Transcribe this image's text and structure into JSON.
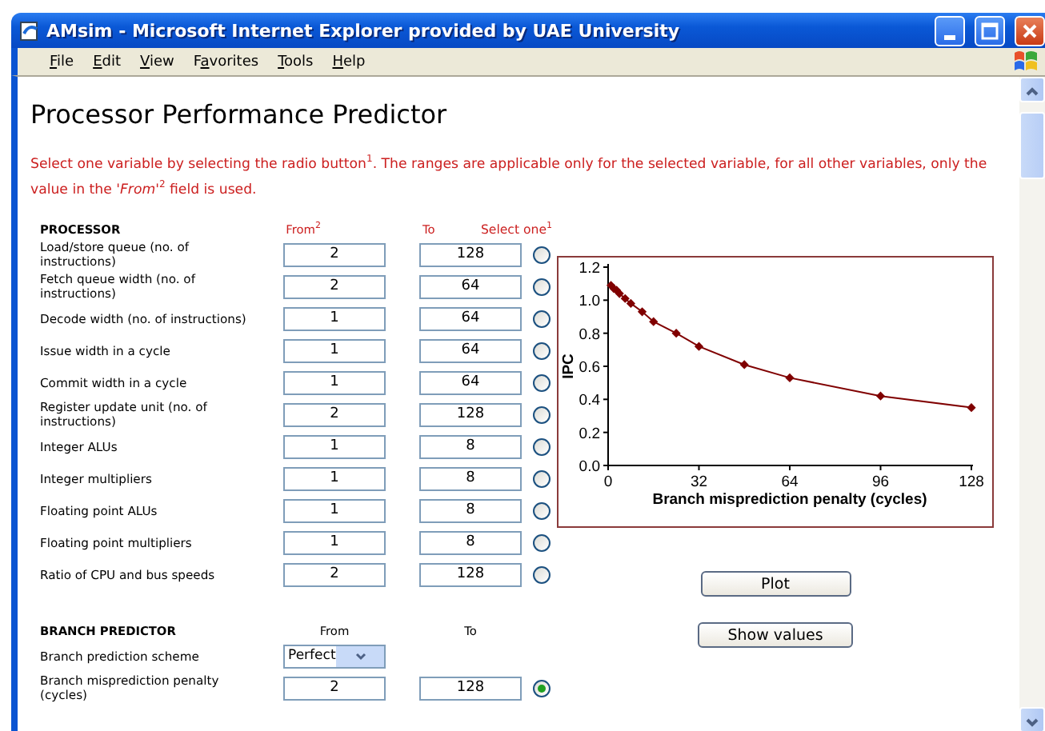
{
  "window": {
    "title": "AMsim - Microsoft Internet Explorer provided by UAE University"
  },
  "menu": [
    {
      "parts": [
        {
          "text": "F",
          "underlined": true
        },
        {
          "text": "ile",
          "underlined": false
        }
      ]
    },
    {
      "parts": [
        {
          "text": "E",
          "underlined": true
        },
        {
          "text": "dit",
          "underlined": false
        }
      ]
    },
    {
      "parts": [
        {
          "text": "V",
          "underlined": true
        },
        {
          "text": "iew",
          "underlined": false
        }
      ]
    },
    {
      "parts": [
        {
          "text": "F",
          "underlined": false
        },
        {
          "text": "a",
          "underlined": true
        },
        {
          "text": "vorites",
          "underlined": false
        }
      ]
    },
    {
      "parts": [
        {
          "text": "T",
          "underlined": true
        },
        {
          "text": "ools",
          "underlined": false
        }
      ]
    },
    {
      "parts": [
        {
          "text": "H",
          "underlined": true
        },
        {
          "text": "elp",
          "underlined": false
        }
      ]
    }
  ],
  "page": {
    "title": "Processor Performance Predictor",
    "intro": "Select one variable by selecting the radio button$^{1}$. The ranges are applicable only for the selected variable, for all other variables, only the value in the *'From'*$^{2}$ field is used."
  },
  "processor": {
    "heading": "PROCESSOR",
    "columns": {
      "from": "From$^{2}$",
      "to": "To",
      "select": "Select one$^{1}$"
    },
    "rows": [
      {
        "label": "Load/store queue (no. of instructions)",
        "from": "2",
        "to": "128",
        "selected": false
      },
      {
        "label": "Fetch queue width (no. of instructions)",
        "from": "2",
        "to": "64",
        "selected": false
      },
      {
        "label": "Decode width (no. of instructions)",
        "from": "1",
        "to": "64",
        "selected": false
      },
      {
        "label": "Issue width in a cycle",
        "from": "1",
        "to": "64",
        "selected": false
      },
      {
        "label": "Commit width in a cycle",
        "from": "1",
        "to": "64",
        "selected": false
      },
      {
        "label": "Register update unit (no. of instructions)",
        "from": "2",
        "to": "128",
        "selected": false
      },
      {
        "label": "Integer ALUs",
        "from": "1",
        "to": "8",
        "selected": false
      },
      {
        "label": "Integer multipliers",
        "from": "1",
        "to": "8",
        "selected": false
      },
      {
        "label": "Floating point ALUs",
        "from": "1",
        "to": "8",
        "selected": false
      },
      {
        "label": "Floating point multipliers",
        "from": "1",
        "to": "8",
        "selected": false
      },
      {
        "label": "Ratio of CPU and bus speeds",
        "from": "2",
        "to": "128",
        "selected": false
      }
    ]
  },
  "branch_predictor": {
    "heading": "BRANCH PREDICTOR",
    "columns": {
      "from": "From",
      "to": "To"
    },
    "rows": [
      {
        "kind": "select",
        "label": "Branch prediction scheme",
        "value": "Perfect"
      },
      {
        "kind": "range",
        "label": "Branch misprediction penalty (cycles)",
        "from": "2",
        "to": "128",
        "selected": true
      }
    ]
  },
  "chart_data": {
    "type": "line",
    "xlabel": "Branch misprediction penalty (cycles)",
    "ylabel": "IPC",
    "x": [
      1,
      2,
      3,
      4,
      6,
      8,
      12,
      16,
      24,
      32,
      48,
      64,
      96,
      128
    ],
    "series": [
      {
        "color": "#800000",
        "marker": "diamond",
        "values": [
          1.09,
          1.07,
          1.06,
          1.04,
          1.01,
          0.98,
          0.93,
          0.87,
          0.8,
          0.72,
          0.61,
          0.53,
          0.42,
          0.35
        ]
      }
    ],
    "xlim": [
      0,
      128
    ],
    "ylim": [
      0,
      1.2
    ],
    "xticks": [
      0,
      32,
      64,
      96,
      128
    ],
    "yticks": [
      {
        "value": 0,
        "label": "0.0"
      },
      {
        "value": 0.2,
        "label": "0.2"
      },
      {
        "value": 0.4,
        "label": "0.4"
      },
      {
        "value": 0.6,
        "label": "0.6"
      },
      {
        "value": 0.8,
        "label": "0.8"
      },
      {
        "value": 1,
        "label": "1.0"
      },
      {
        "value": 1.2,
        "label": "1.2"
      }
    ]
  },
  "buttons": [
    {
      "label": "Plot"
    },
    {
      "label": "Show values"
    }
  ]
}
